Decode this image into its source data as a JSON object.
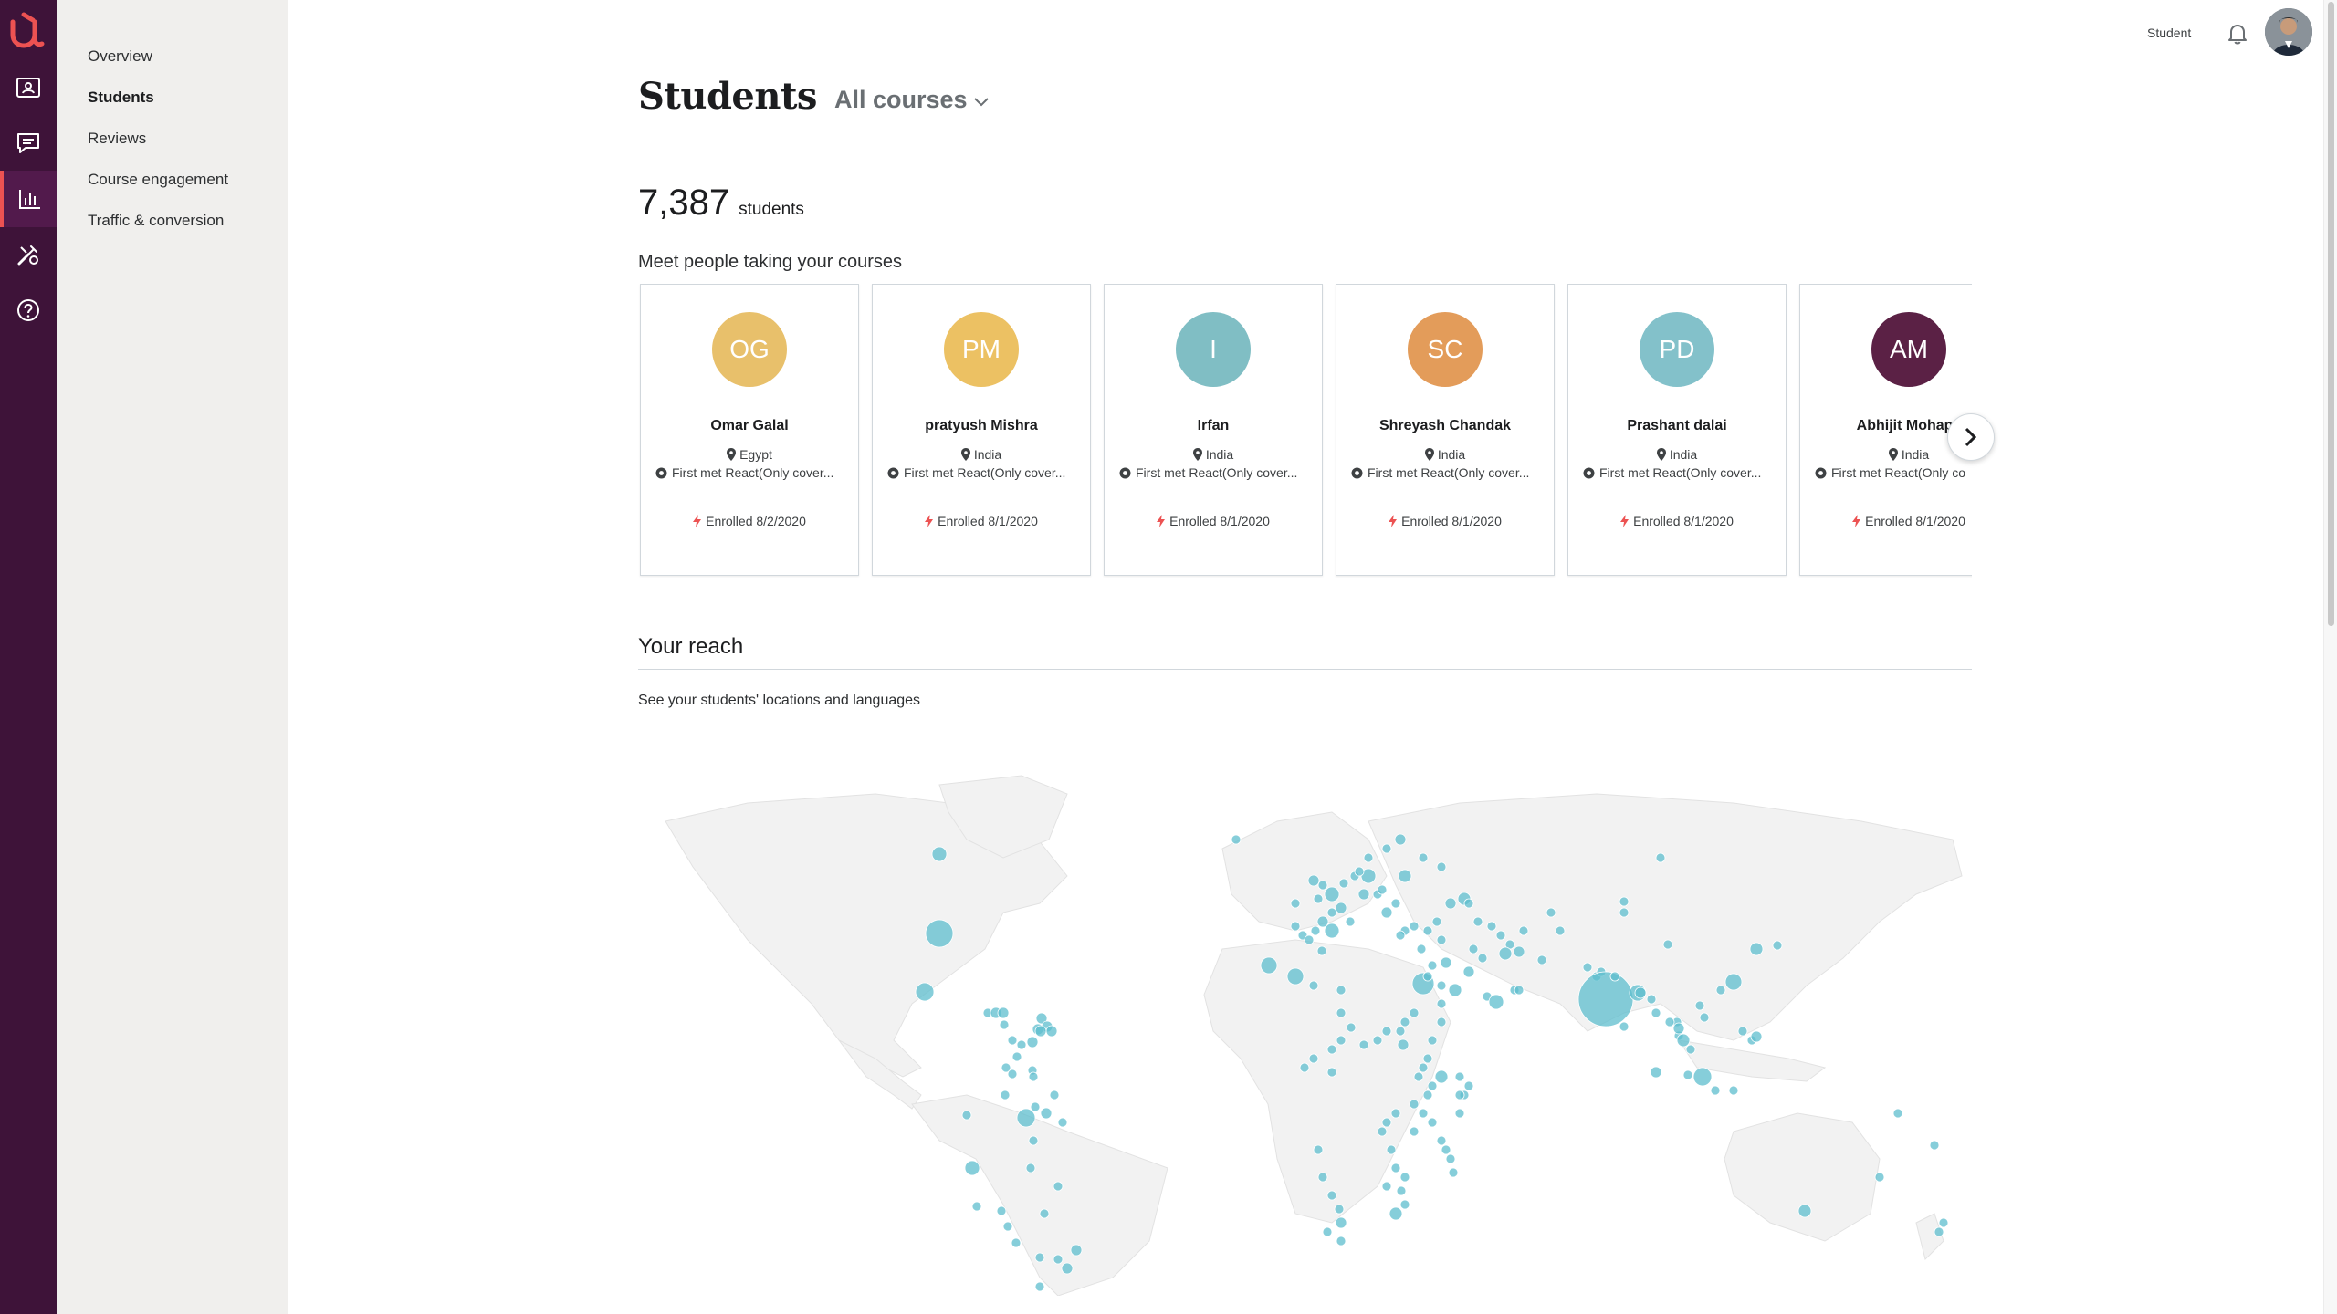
{
  "sidebar": {
    "items": [
      {
        "label": "Overview",
        "active": false
      },
      {
        "label": "Students",
        "active": true
      },
      {
        "label": "Reviews",
        "active": false
      },
      {
        "label": "Course engagement",
        "active": false
      },
      {
        "label": "Traffic & conversion",
        "active": false
      }
    ]
  },
  "rail": {
    "icons": [
      "udemy-logo-icon",
      "courses-icon",
      "communication-icon",
      "performance-icon",
      "tools-icon",
      "help-icon"
    ],
    "active": "performance-icon"
  },
  "header": {
    "student_link": "Student"
  },
  "page": {
    "title": "Students",
    "course_filter": "All courses"
  },
  "stats": {
    "count": "7,387",
    "unit": "students"
  },
  "students": {
    "heading": "Meet people taking your courses",
    "items": [
      {
        "initials": "OG",
        "name": "Omar Galal",
        "location": "Egypt",
        "course": "First met React(Only cover...",
        "enrolled": "Enrolled 8/2/2020",
        "color": "#e8c06b"
      },
      {
        "initials": "PM",
        "name": "pratyush Mishra",
        "location": "India",
        "course": "First met React(Only cover...",
        "enrolled": "Enrolled 8/1/2020",
        "color": "#ecc163"
      },
      {
        "initials": "I",
        "name": "Irfan",
        "location": "India",
        "course": "First met React(Only cover...",
        "enrolled": "Enrolled 8/1/2020",
        "color": "#80bec4"
      },
      {
        "initials": "SC",
        "name": "Shreyash Chandak",
        "location": "India",
        "course": "First met React(Only cover...",
        "enrolled": "Enrolled 8/1/2020",
        "color": "#e39c5a"
      },
      {
        "initials": "PD",
        "name": "Prashant dalai",
        "location": "India",
        "course": "First met React(Only cover...",
        "enrolled": "Enrolled 8/1/2020",
        "color": "#83c1ca"
      },
      {
        "initials": "AM",
        "name": "Abhijit Mohapa",
        "location": "India",
        "course": "First met React(Only co",
        "enrolled": "Enrolled 8/1/2020",
        "color": "#5b2145"
      }
    ]
  },
  "reach": {
    "heading": "Your reach",
    "subtitle": "See your students' locations and languages",
    "bubble_color": "#5dbecd",
    "land_color": "#f2f2f2"
  }
}
